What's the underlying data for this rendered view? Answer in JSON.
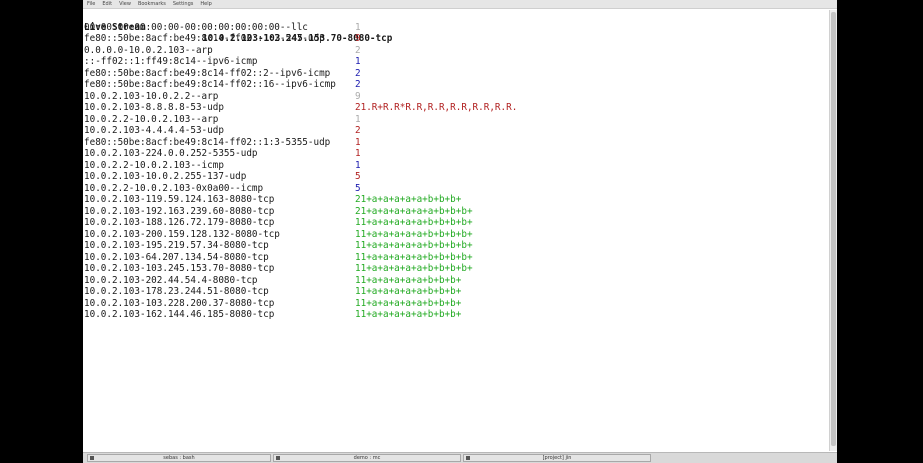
{
  "colors": {
    "gray": "#aaaaaa",
    "red": "#b22222",
    "blue": "#1c1cb0",
    "green": "#22aa22",
    "text": "#1a1a1a"
  },
  "menubar": {
    "items": [
      "File",
      "Edit",
      "View",
      "Bookmarks",
      "Settings",
      "Help"
    ]
  },
  "terminal": {
    "header": {
      "label": "Live Stream",
      "stream": "10.0.2.103-103.245.153.70-8080-tcp"
    },
    "rows": [
      {
        "name": "00:00:00:00:00:00-00:00:00:00:00:00--llc",
        "value": "1",
        "color": "gray"
      },
      {
        "name": "fe80::50be:8acf:be49:8c14-ff02::1:2-547-udp",
        "value": "9",
        "color": "red"
      },
      {
        "name": "0.0.0.0-10.0.2.103--arp",
        "value": "2",
        "color": "gray"
      },
      {
        "name": "::-ff02::1:ff49:8c14--ipv6-icmp",
        "value": "1",
        "color": "blue"
      },
      {
        "name": "fe80::50be:8acf:be49:8c14-ff02::2--ipv6-icmp",
        "value": "2",
        "color": "blue"
      },
      {
        "name": "fe80::50be:8acf:be49:8c14-ff02::16--ipv6-icmp",
        "value": "2",
        "color": "blue"
      },
      {
        "name": "10.0.2.103-10.0.2.2--arp",
        "value": "9",
        "color": "gray"
      },
      {
        "name": "10.0.2.103-8.8.8.8-53-udp",
        "value": "21.R+R.R*R.R,R.R,R.R,R.R,R.R.",
        "color": "red"
      },
      {
        "name": "10.0.2.2-10.0.2.103--arp",
        "value": "1",
        "color": "gray"
      },
      {
        "name": "10.0.2.103-4.4.4.4-53-udp",
        "value": "2",
        "color": "red"
      },
      {
        "name": "fe80::50be:8acf:be49:8c14-ff02::1:3-5355-udp",
        "value": "1",
        "color": "red"
      },
      {
        "name": "10.0.2.103-224.0.0.252-5355-udp",
        "value": "1",
        "color": "red"
      },
      {
        "name": "10.0.2.2-10.0.2.103--icmp",
        "value": "1",
        "color": "blue"
      },
      {
        "name": "10.0.2.103-10.0.2.255-137-udp",
        "value": "5",
        "color": "red"
      },
      {
        "name": "10.0.2.2-10.0.2.103-0x0a00--icmp",
        "value": "5",
        "color": "blue"
      },
      {
        "name": "10.0.2.103-119.59.124.163-8080-tcp",
        "value": "21+a+a+a+a+a+b+b+b+",
        "color": "green"
      },
      {
        "name": "10.0.2.103-192.163.239.60-8080-tcp",
        "value": "21+a+a+a+a+a+a+b+b+b+",
        "color": "green"
      },
      {
        "name": "10.0.2.103-188.126.72.179-8080-tcp",
        "value": "11+a+a+a+a+a+b+b+b+b+",
        "color": "green"
      },
      {
        "name": "10.0.2.103-200.159.128.132-8080-tcp",
        "value": "11+a+a+a+a+a+b+b+b+b+",
        "color": "green"
      },
      {
        "name": "10.0.2.103-195.219.57.34-8080-tcp",
        "value": "11+a+a+a+a+a+b+b+b+b+",
        "color": "green"
      },
      {
        "name": "10.0.2.103-64.207.134.54-8080-tcp",
        "value": "11+a+a+a+a+a+b+b+b+b+",
        "color": "green"
      },
      {
        "name": "10.0.2.103-103.245.153.70-8080-tcp",
        "value": "11+a+a+a+a+a+b+b+b+b+",
        "color": "green"
      },
      {
        "name": "10.0.2.103-202.44.54.4-8080-tcp",
        "value": "11+a+a+a+a+a+b+b+b+",
        "color": "green"
      },
      {
        "name": "10.0.2.103-178.23.244.51-8080-tcp",
        "value": "11+a+a+a+a+a+b+b+b+",
        "color": "green"
      },
      {
        "name": "10.0.2.103-103.228.200.37-8080-tcp",
        "value": "11+a+a+a+a+a+b+b+b+",
        "color": "green"
      },
      {
        "name": "10.0.2.103-162.144.46.185-8080-tcp",
        "value": "11+a+a+a+a+a+b+b+b+",
        "color": "green"
      }
    ]
  },
  "taskbar": {
    "tasks": [
      {
        "label": "sebas : bash",
        "icon": "terminal-icon"
      },
      {
        "label": "demo : mc",
        "icon": "terminal-icon"
      },
      {
        "label": "[project] jin",
        "icon": "terminal-icon"
      }
    ]
  }
}
